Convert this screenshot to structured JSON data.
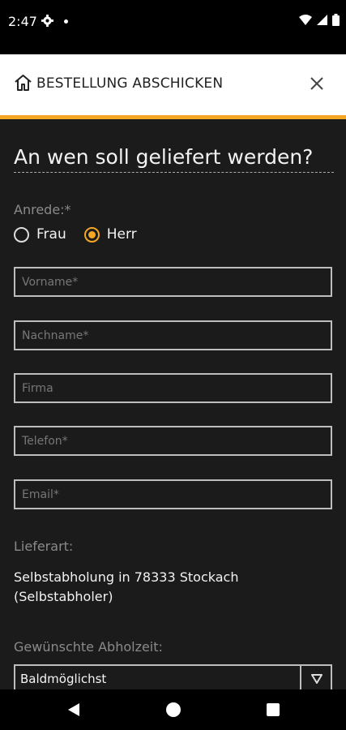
{
  "status_bar": {
    "time": "2:47"
  },
  "header": {
    "title": "BESTELLUNG ABSCHICKEN"
  },
  "form": {
    "section_title": "An wen soll geliefert werden?",
    "salutation_label": "Anrede:*",
    "salutation_options": [
      "Frau",
      "Herr"
    ],
    "salutation_selected": "Herr",
    "fields": {
      "vorname_placeholder": "Vorname*",
      "nachname_placeholder": "Nachname*",
      "firma_placeholder": "Firma",
      "telefon_placeholder": "Telefon*",
      "email_placeholder": "Email*"
    },
    "delivery_label": "Lieferart:",
    "delivery_value": "Selbstabholung in 78333 Stockach (Selbstabholer)",
    "pickup_label": "Gewünschte Abholzeit:",
    "pickup_value": "Baldmöglichst"
  },
  "colors": {
    "accent": "#f5a623",
    "background": "#1b1b1b",
    "header_bg": "#ffffff"
  },
  "icons": [
    "settings-icon",
    "home-icon",
    "close-icon",
    "wifi-icon",
    "signal-icon",
    "battery-icon",
    "dropdown-arrow-icon",
    "back-icon",
    "home-nav-icon",
    "recents-icon"
  ]
}
